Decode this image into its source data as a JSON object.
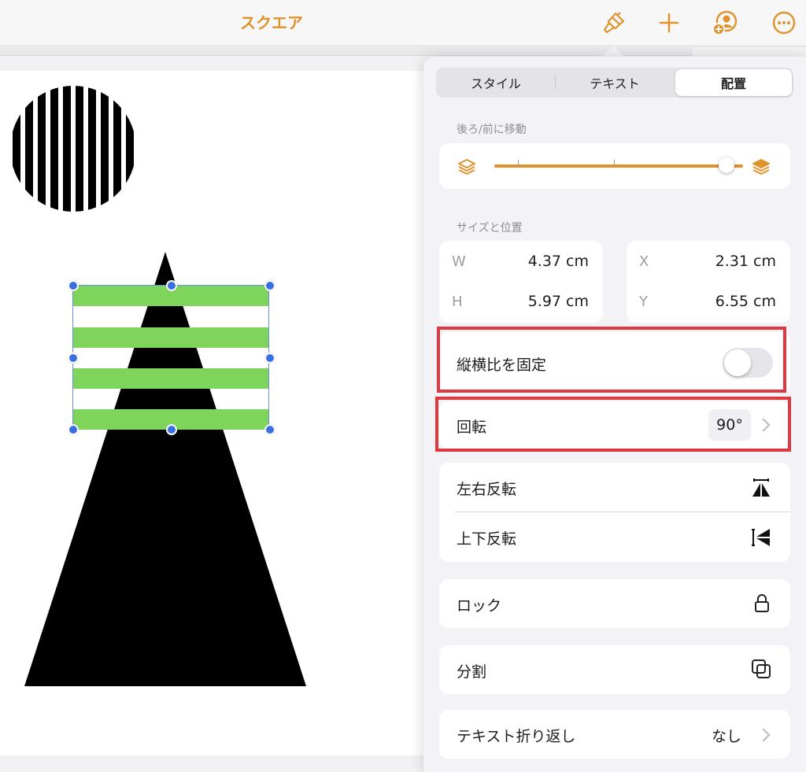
{
  "header": {
    "title": "スクエア",
    "accent_color": "#e0922a",
    "icons": [
      "paintbrush-icon",
      "plus-icon",
      "collaborate-icon",
      "more-icon"
    ]
  },
  "popover": {
    "tabs": [
      {
        "label": "スタイル",
        "active": false
      },
      {
        "label": "テキスト",
        "active": false
      },
      {
        "label": "配置",
        "active": true
      }
    ],
    "arrange": {
      "label": "後ろ/前に移動",
      "slider_value": 1.0
    },
    "size_position": {
      "label": "サイズと位置",
      "w_key": "W",
      "w_value": "4.37 cm",
      "h_key": "H",
      "h_value": "5.97 cm",
      "x_key": "X",
      "x_value": "2.31 cm",
      "y_key": "Y",
      "y_value": "6.55 cm"
    },
    "lock_ratio": {
      "label": "縦横比を固定",
      "on": false
    },
    "rotate": {
      "label": "回転",
      "value": "90°"
    },
    "flip_h": {
      "label": "左右反転"
    },
    "flip_v": {
      "label": "上下反転"
    },
    "lock": {
      "label": "ロック"
    },
    "split": {
      "label": "分割"
    },
    "text_wrap": {
      "label": "テキスト折り返し",
      "value": "なし"
    },
    "highlight_color": "#e0383f"
  },
  "canvas": {
    "stripe_color": "#7fd55b",
    "selection_color": "#3a6fe0"
  }
}
